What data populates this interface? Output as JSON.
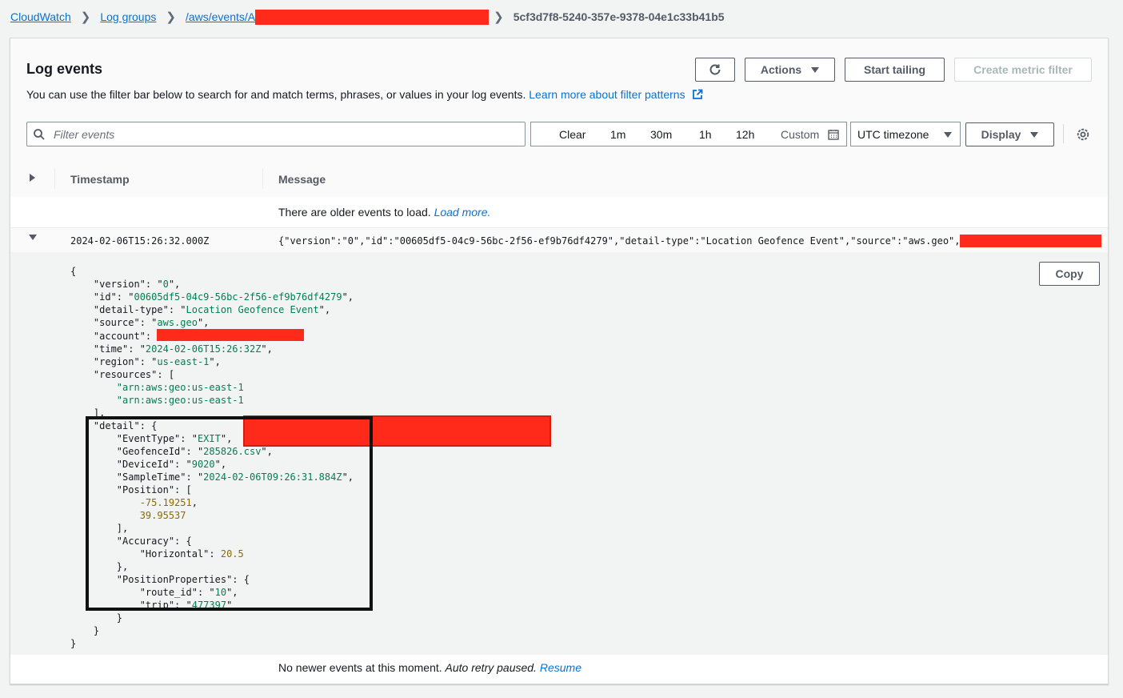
{
  "breadcrumb": {
    "items": [
      "CloudWatch",
      "Log groups",
      "/aws/events/A"
    ],
    "current": "5cf3d7f8-5240-357e-9378-04e1c33b41b5"
  },
  "panel": {
    "title": "Log events",
    "description": "You can use the filter bar below to search for and match terms, phrases, or values in your log events.",
    "learn_more": "Learn more about filter patterns",
    "buttons": {
      "refresh_icon": "refresh-icon",
      "actions": "Actions",
      "start_tailing": "Start tailing",
      "create_metric_filter": "Create metric filter"
    },
    "filter": {
      "placeholder": "Filter events"
    },
    "time_range": {
      "clear": "Clear",
      "options": [
        "1m",
        "30m",
        "1h",
        "12h"
      ],
      "custom": "Custom"
    },
    "timezone": "UTC timezone",
    "display": "Display"
  },
  "table": {
    "columns": [
      "Timestamp",
      "Message"
    ],
    "older_text": "There are older events to load.",
    "load_more": "Load more.",
    "event": {
      "timestamp": "2024-02-06T15:26:32.000Z",
      "message": "{\"version\":\"0\",\"id\":\"00605df5-04c9-56bc-2f56-ef9b76df4279\",\"detail-type\":\"Location Geofence Event\",\"source\":\"aws.geo\","
    },
    "copy": "Copy",
    "json_lines": {
      "version": "0",
      "id": "00605df5-04c9-56bc-2f56-ef9b76df4279",
      "detail_type": "Location Geofence Event",
      "source": "aws.geo",
      "time": "2024-02-06T15:26:32Z",
      "region": "us-east-1",
      "resource_prefix": "arn:aws:geo:us-east-1",
      "EventType": "EXIT",
      "GeofenceId": "285826.csv",
      "DeviceId": "9020",
      "SampleTime": "2024-02-06T09:26:31.884Z",
      "position_lon": "-75.19251",
      "position_lat": "39.95537",
      "horizontal": "20.5",
      "route_id": "10",
      "trip": "477397"
    },
    "newer_text": "No newer events at this moment.",
    "auto_retry": "Auto retry paused.",
    "resume": "Resume"
  }
}
